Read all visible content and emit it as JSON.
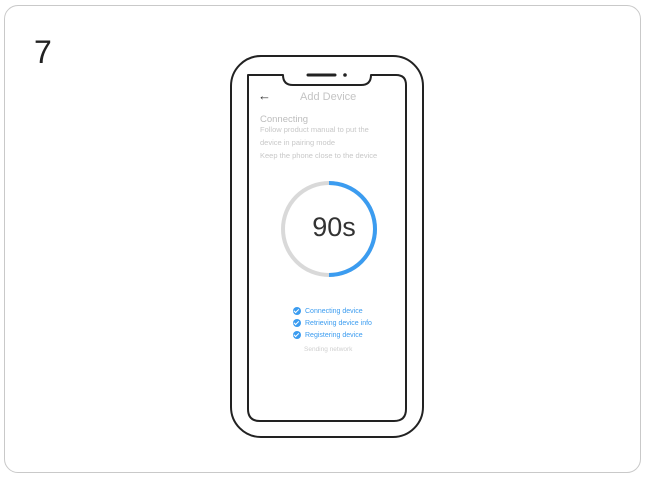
{
  "step": {
    "number": "7"
  },
  "screen": {
    "back_icon": "←",
    "title": "Add Device",
    "heading": "Connecting",
    "instructions": [
      "Follow product manual to put the",
      "device in pairing mode",
      "Keep the phone close to the device"
    ],
    "timer": "90s",
    "progress_fraction": 0.5,
    "steps_done": [
      {
        "label": "Connecting device",
        "icon": "check-circle-icon"
      },
      {
        "label": "Retrieving device info",
        "icon": "check-circle-icon"
      },
      {
        "label": "Registering device",
        "icon": "check-circle-icon"
      }
    ],
    "step_pending": "Sending network"
  },
  "colors": {
    "accent": "#3b9cf0",
    "track": "#d9d9d9",
    "outline": "#222222"
  }
}
